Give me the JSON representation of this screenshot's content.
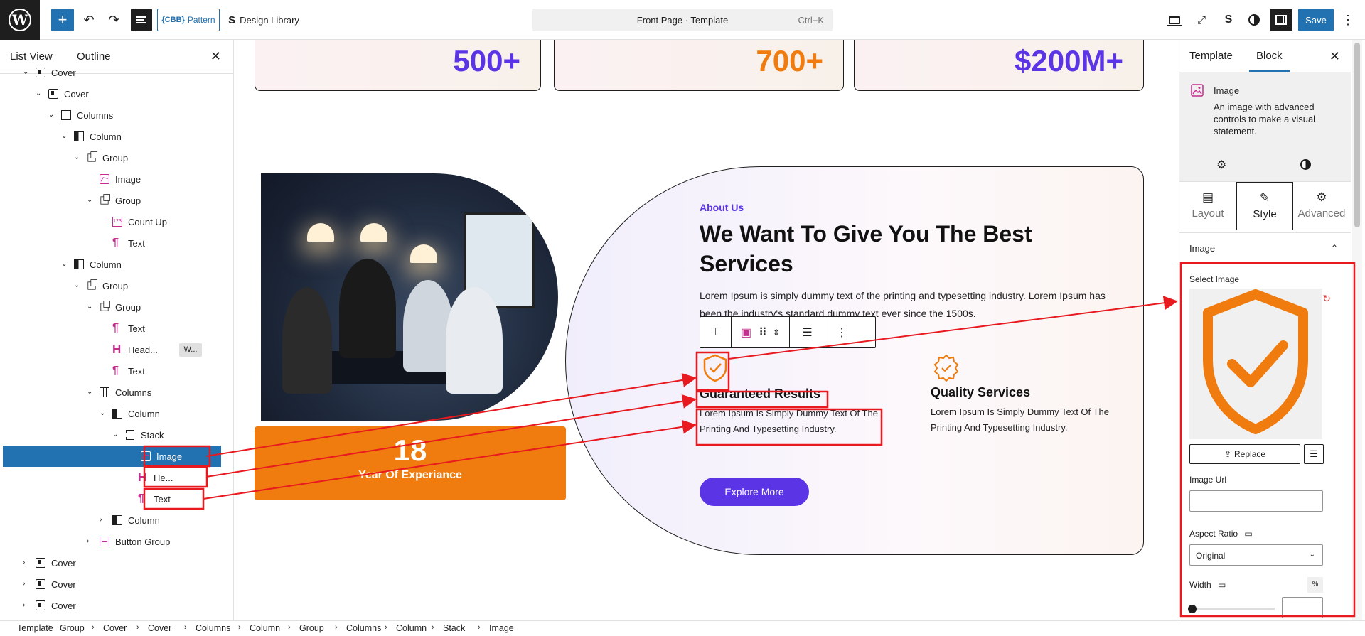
{
  "toolbar": {
    "pattern_label": "Pattern",
    "pattern_badge": "{CBB}",
    "design_library_label": "Design Library",
    "command_title": "Front Page · Template",
    "command_shortcut": "Ctrl+K",
    "save_label": "Save"
  },
  "list_view": {
    "tab_list": "List View",
    "tab_outline": "Outline",
    "items": [
      {
        "label": "Cover",
        "icon": "cover"
      },
      {
        "label": "Cover",
        "icon": "cover"
      },
      {
        "label": "Columns",
        "icon": "columns"
      },
      {
        "label": "Column",
        "icon": "column"
      },
      {
        "label": "Group",
        "icon": "group"
      },
      {
        "label": "Image",
        "icon": "image"
      },
      {
        "label": "Group",
        "icon": "group"
      },
      {
        "label": "Count Up",
        "icon": "countup"
      },
      {
        "label": "Text",
        "icon": "paragraph"
      },
      {
        "label": "Column",
        "icon": "column"
      },
      {
        "label": "Group",
        "icon": "group"
      },
      {
        "label": "Group",
        "icon": "group"
      },
      {
        "label": "Text",
        "icon": "paragraph"
      },
      {
        "label": "Head...",
        "icon": "heading",
        "badge": "W..."
      },
      {
        "label": "Text",
        "icon": "paragraph"
      },
      {
        "label": "Columns",
        "icon": "columns"
      },
      {
        "label": "Column",
        "icon": "column"
      },
      {
        "label": "Stack",
        "icon": "stack"
      },
      {
        "label": "Image",
        "icon": "image"
      },
      {
        "label": "He...",
        "icon": "heading"
      },
      {
        "label": "Text",
        "icon": "paragraph"
      },
      {
        "label": "Column",
        "icon": "column"
      },
      {
        "label": "Button Group",
        "icon": "buttongroup"
      },
      {
        "label": "Cover",
        "icon": "cover"
      },
      {
        "label": "Cover",
        "icon": "cover"
      },
      {
        "label": "Cover",
        "icon": "cover"
      }
    ]
  },
  "canvas": {
    "stats": [
      "500+",
      "700+",
      "$200M+"
    ],
    "experience_number": "18",
    "experience_label": "Year Of Experiance",
    "about_label": "About Us",
    "about_title": "We Want To Give You The Best Services",
    "about_desc": "Lorem Ipsum is simply dummy text of the printing and typesetting industry. Lorem Ipsum has been the industry's standard dummy text ever since the 1500s.",
    "feature1_title": "Guaranteed Results",
    "feature1_desc": "Lorem Ipsum Is Simply Dummy Text Of The Printing And Typesetting Industry.",
    "feature2_title": "Quality Services",
    "feature2_desc": "Lorem Ipsum Is Simply Dummy Text Of The Printing And Typesetting Industry.",
    "explore_label": "Explore More",
    "colors": {
      "purple": "#5b35e5",
      "orange": "#f07c0f"
    }
  },
  "inspector": {
    "tab_template": "Template",
    "tab_block": "Block",
    "block_name": "Image",
    "block_desc": "An image with advanced controls to make a visual statement.",
    "tab_layout": "Layout",
    "tab_style": "Style",
    "tab_advanced": "Advanced",
    "panel_title": "Image",
    "select_image_label": "Select Image",
    "replace_label": "Replace",
    "image_url_label": "Image Url",
    "image_url_value": "",
    "aspect_ratio_label": "Aspect Ratio",
    "aspect_ratio_value": "Original",
    "width_label": "Width",
    "width_unit": "%",
    "width_value": ""
  },
  "breadcrumbs": [
    "Template",
    "Group",
    "Cover",
    "Cover",
    "Columns",
    "Column",
    "Group",
    "Columns",
    "Column",
    "Stack",
    "Image"
  ]
}
